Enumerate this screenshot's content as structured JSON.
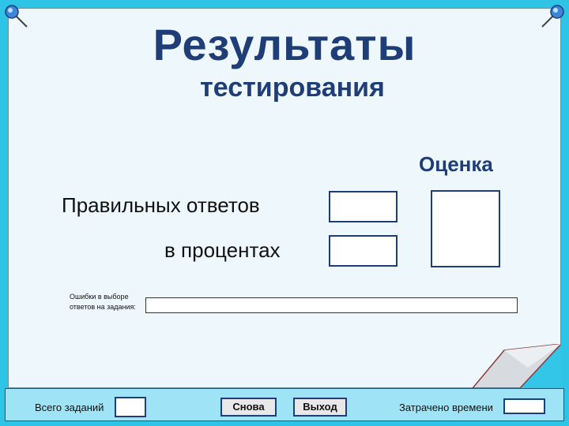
{
  "header": {
    "title": "Результаты",
    "subtitle": "тестирования"
  },
  "results": {
    "correct_label": "Правильных ответов",
    "percent_label": "в процентах",
    "grade_label": "Оценка",
    "errors_label": "Ошибки в выборе ответов на задания:",
    "correct_value": "",
    "percent_value": "",
    "grade_value": "",
    "errors_value": ""
  },
  "footer": {
    "total_label": "Всего заданий",
    "total_value": "",
    "again_label": "Снова",
    "exit_label": "Выход",
    "time_label": "Затрачено времени",
    "time_value": ""
  },
  "colors": {
    "frame": "#2ec4e6",
    "paper": "#eef8fc",
    "title": "#1f3e77",
    "button_border": "#1f3e77"
  },
  "icons": [
    "pushpin-icon",
    "pushpin-icon",
    "page-curl"
  ]
}
